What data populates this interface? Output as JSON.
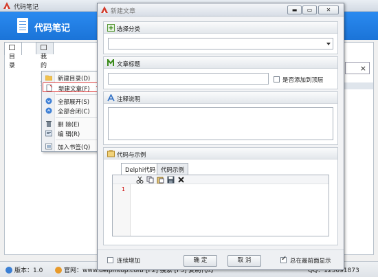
{
  "main": {
    "title": "代码笔记",
    "header_name": "代码笔记",
    "tabs": [
      {
        "label": "目录"
      },
      {
        "label": "我的书签"
      }
    ]
  },
  "statusbar": {
    "version": "版本：1.0",
    "website": "官网：www.delphitop.com",
    "hotkeys": "：[F2] 搜索  [F3] 复制代码",
    "qq": "QQ：125091873"
  },
  "context_menu": {
    "items": [
      {
        "label": "新建目录(D)",
        "icon": "folder-icon"
      },
      {
        "label": "新建文章(F)",
        "icon": "new-document-icon"
      },
      {
        "label": "全部展开(S)",
        "icon": "expand-all-icon"
      },
      {
        "label": "全部合闭(C)",
        "icon": "collapse-all-icon"
      },
      {
        "label": "删 除(E)",
        "icon": "trash-icon"
      },
      {
        "label": "编 辑(R)",
        "icon": "edit-icon"
      },
      {
        "label": "加入书签(Q)",
        "icon": "bookmark-icon"
      }
    ]
  },
  "dialog": {
    "title": "新建文章",
    "window_buttons": {
      "minimize": "▬",
      "maximize": "▭",
      "close": "✕"
    },
    "category": {
      "label": "选择分类",
      "value": ""
    },
    "article_title": {
      "label": "文章标题",
      "value": "",
      "pin_label": "是否添加到顶层",
      "pin_checked": false
    },
    "notes": {
      "label": "注释说明",
      "value": ""
    },
    "code": {
      "label": "代码与示例",
      "tabs": [
        {
          "label": "Delphi代码"
        },
        {
          "label": "代码示例"
        }
      ],
      "line_number": "1",
      "toolbar_icons": [
        "cut-icon",
        "copy-icon",
        "paste-icon",
        "save-icon",
        "delete-icon"
      ]
    },
    "continuous_add": {
      "label": "连续增加",
      "checked": false
    },
    "ok_label": "确 定",
    "cancel_label": "取 消",
    "always_on_top": {
      "label": "总在最前面显示",
      "checked": true
    }
  },
  "colors": {
    "header_blue": "#1b74d8",
    "highlight_red": "#e04040"
  }
}
